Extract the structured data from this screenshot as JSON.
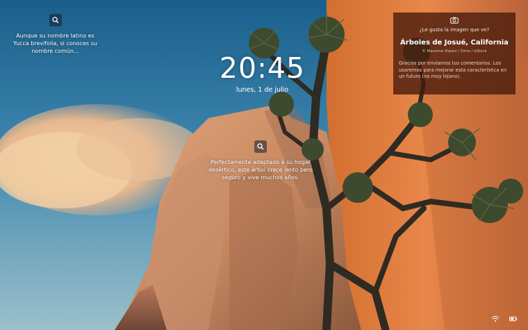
{
  "clock": {
    "time": "20:45",
    "date": "lunes, 1 de julio"
  },
  "hotspots": [
    {
      "text": "Aunque su nombre latino es Yucca brevifolia, si conoces su nombre común...",
      "icon": "search-icon"
    },
    {
      "text": "Perfectamente adaptado a su hogar desértico, este árbol crece lento pero seguro y vive muchos años.",
      "icon": "search-icon"
    }
  ],
  "info_card": {
    "icon": "camera-icon",
    "question": "¿Le gusta la imagen que ve?",
    "title": "Árboles de Josué, California",
    "credit": "© Massimo Ripani / Sime / eStock",
    "thanks": "Gracias por enviarnos tus comentarios. Los usaremos para mejorar esta característica en un futuro (no muy lejano)."
  },
  "tray": {
    "icons": [
      "wifi-icon",
      "battery-icon"
    ]
  },
  "colors": {
    "sky_top": "#1b6494",
    "sky_bottom": "#8fb7c6",
    "rock": "#d38a58",
    "card": "#46190c"
  }
}
